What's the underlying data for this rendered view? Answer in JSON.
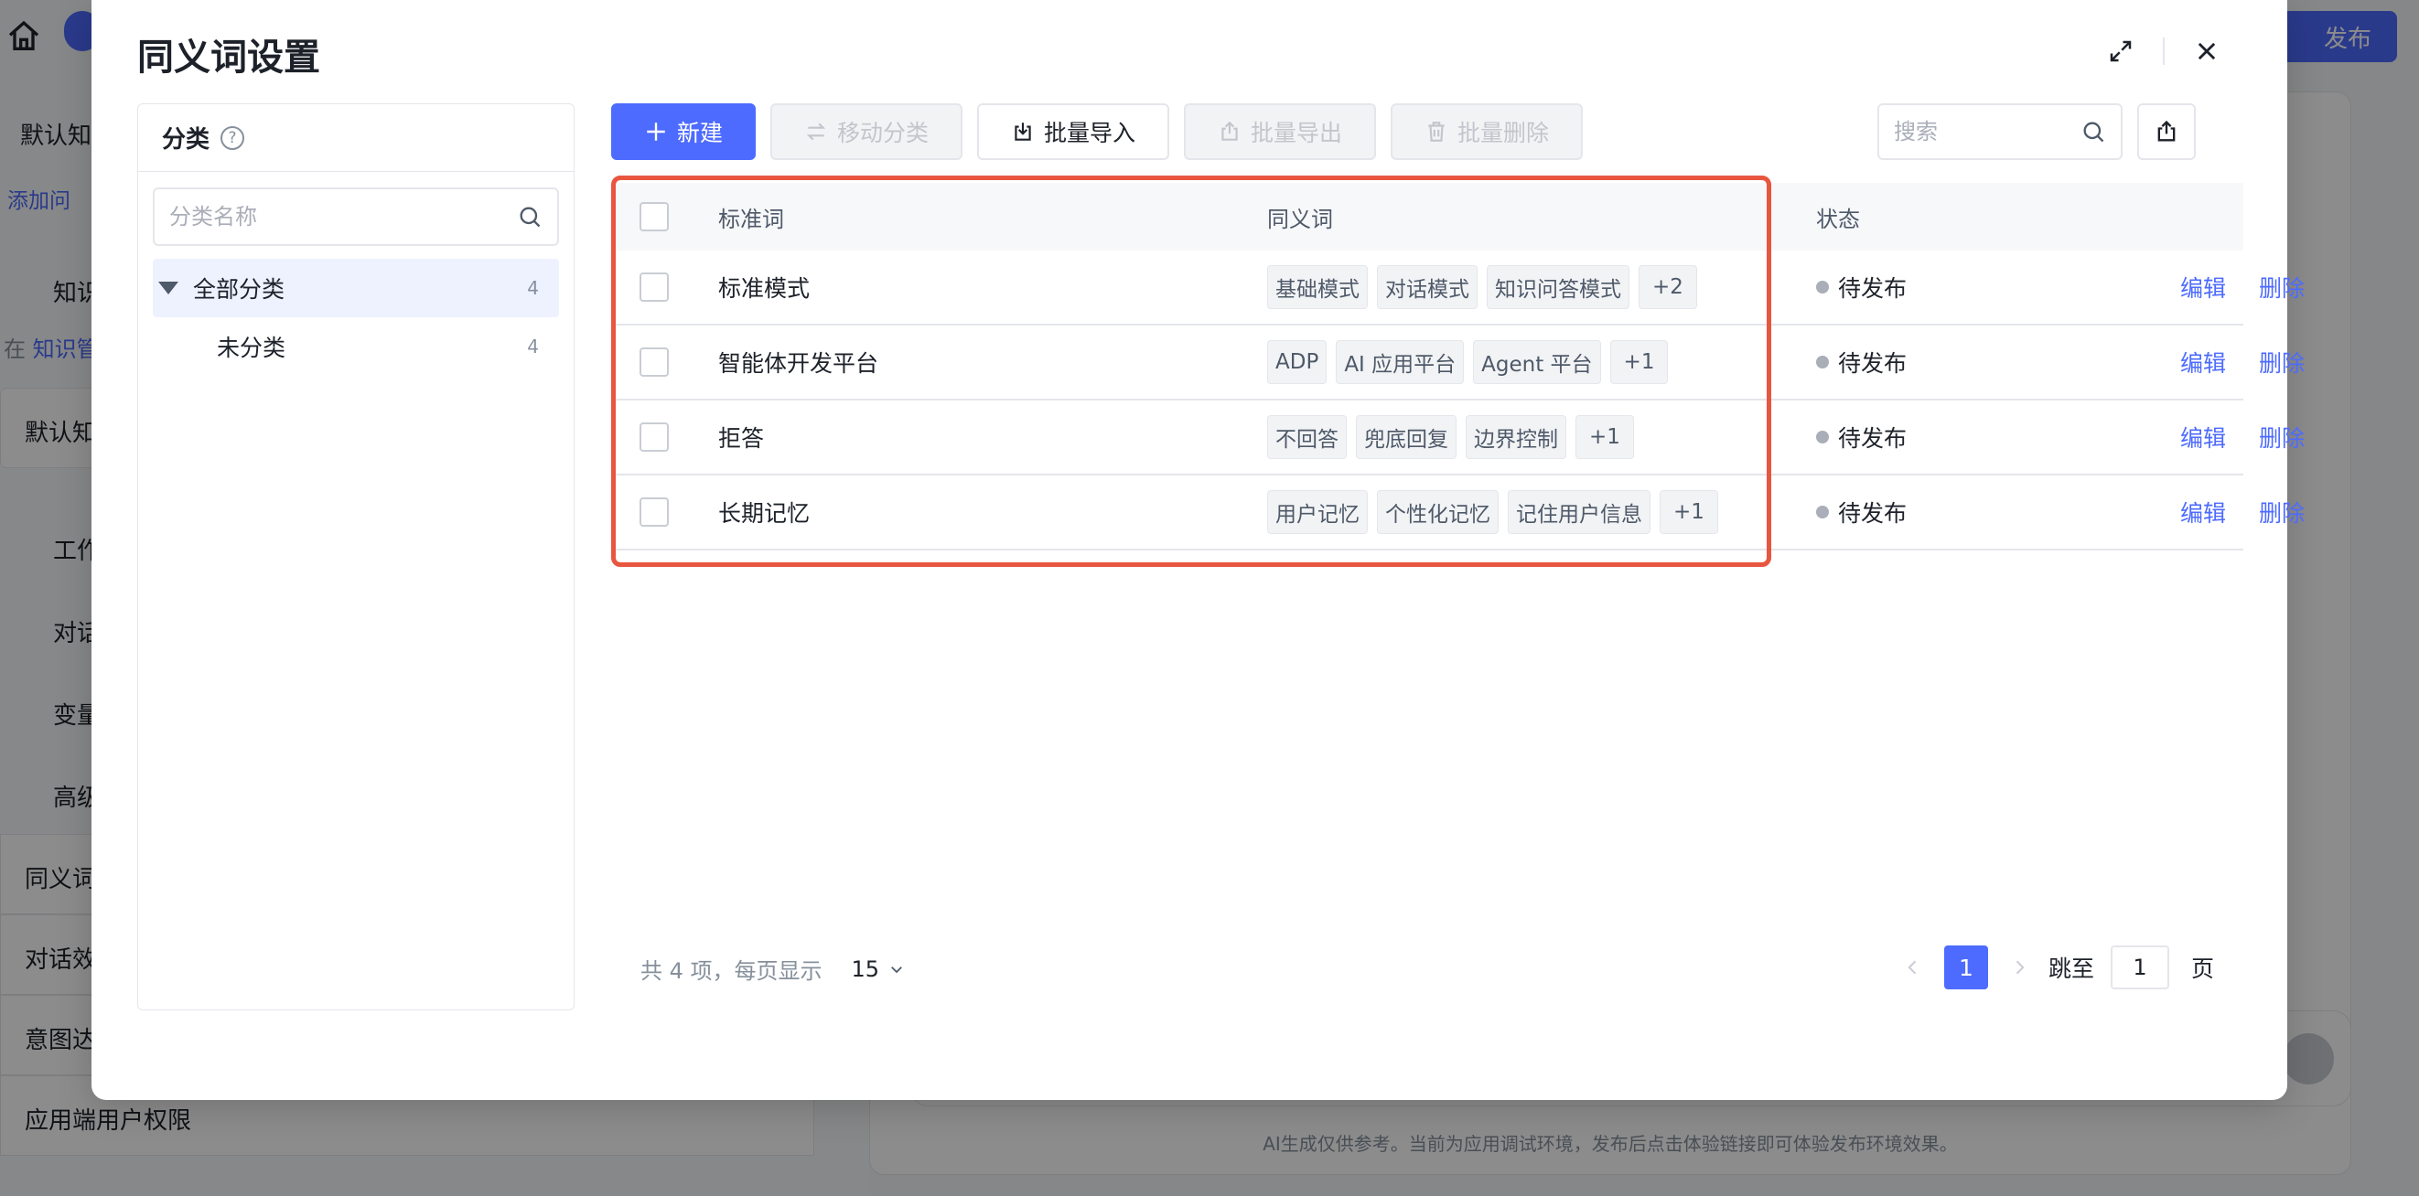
{
  "background": {
    "publish_label": "发布",
    "select_label": "默认知",
    "add_question_label": "添加问",
    "knowledge_label": "知识",
    "knowledge_desc_prefix": "在",
    "knowledge_desc_link": "知识管",
    "default_box_label": "默认知",
    "workflow_label": "工作",
    "dialog_label": "对话",
    "variables_label": "变量",
    "advanced_label": "高级",
    "synonyms_row_label": "同义词",
    "dialog_effect_row_label": "对话效",
    "intent_row_label": "意图达",
    "app_user_perm_label": "应用端用户权限",
    "footer_note": "AI生成仅供参考。当前为应用调试环境，发布后点击体验链接即可体验发布环境效果。"
  },
  "modal": {
    "title": "同义词设置"
  },
  "category": {
    "header": "分类",
    "search_placeholder": "分类名称",
    "items": [
      {
        "label": "全部分类",
        "count": "4"
      },
      {
        "label": "未分类",
        "count": "4"
      }
    ]
  },
  "toolbar": {
    "new_label": "新建",
    "move_label": "移动分类",
    "import_label": "批量导入",
    "export_label": "批量导出",
    "delete_label": "批量删除",
    "search_placeholder": "搜索"
  },
  "table": {
    "headers": {
      "standard": "标准词",
      "synonyms": "同义词",
      "status": "状态"
    },
    "rows": [
      {
        "standard": "标准模式",
        "tags": [
          "基础模式",
          "对话模式",
          "知识问答模式"
        ],
        "more": "+2",
        "status": "待发布",
        "edit": "编辑",
        "delete": "删除"
      },
      {
        "standard": "智能体开发平台",
        "tags": [
          "ADP",
          "AI 应用平台",
          "Agent 平台"
        ],
        "more": "+1",
        "status": "待发布",
        "edit": "编辑",
        "delete": "删除"
      },
      {
        "standard": "拒答",
        "tags": [
          "不回答",
          "兜底回复",
          "边界控制"
        ],
        "more": "+1",
        "status": "待发布",
        "edit": "编辑",
        "delete": "删除"
      },
      {
        "standard": "长期记忆",
        "tags": [
          "用户记忆",
          "个性化记忆",
          "记住用户信息"
        ],
        "more": "+1",
        "status": "待发布",
        "edit": "编辑",
        "delete": "删除"
      }
    ]
  },
  "pagination": {
    "summary": "共 4 项，每页显示",
    "page_size": "15",
    "current_page": "1",
    "jump_label": "跳至",
    "jump_value": "1",
    "page_suffix": "页"
  },
  "colors": {
    "primary": "#4d6bfe",
    "highlight": "#e8563f",
    "status_dot": "#a9aeb8"
  }
}
